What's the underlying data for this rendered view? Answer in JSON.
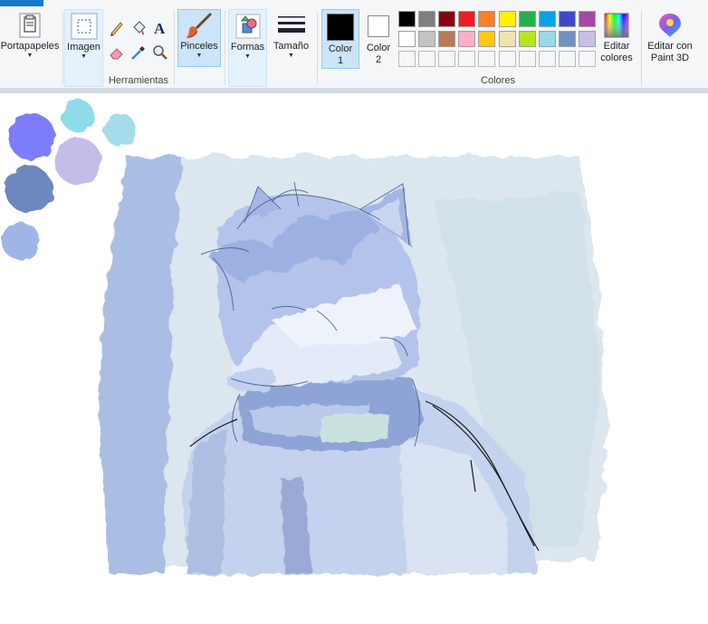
{
  "ribbon": {
    "clipboard": {
      "label": "Portapapeles",
      "icon": "clipboard-icon"
    },
    "image": {
      "label": "Imagen",
      "icon": "select-icon"
    },
    "tools": {
      "group_label": "Herramientas",
      "items": [
        "pencil-icon",
        "fill-icon",
        "text-icon",
        "eraser-icon",
        "color-picker-icon",
        "magnifier-icon"
      ]
    },
    "brushes": {
      "label": "Pinceles",
      "icon": "brush-icon",
      "selected": true
    },
    "shapes": {
      "label": "Formas",
      "icon": "shapes-icon"
    },
    "size": {
      "label": "Tamaño",
      "icon": "line-size-icon"
    },
    "color1": {
      "label": "Color",
      "label2": "1",
      "value": "#000000"
    },
    "color2": {
      "label": "Color",
      "label2": "2",
      "value": "#ffffff"
    },
    "colors_group_label": "Colores",
    "palette_row1": [
      "#000000",
      "#7f7f7f",
      "#880015",
      "#ed1c24",
      "#ff7f27",
      "#fff200",
      "#22b14c",
      "#00a2e8",
      "#3f48cc",
      "#a349a4"
    ],
    "palette_row2": [
      "#ffffff",
      "#c3c3c3",
      "#b97a57",
      "#ffaec9",
      "#ffc90e",
      "#efe4b0",
      "#b5e61d",
      "#99d9ea",
      "#7092be",
      "#c8bfe7"
    ],
    "palette_row3_count": 10,
    "edit_colors": {
      "label": "Editar",
      "label2": "colores"
    },
    "paint3d": {
      "label": "Editar con",
      "label2": "Paint 3D"
    }
  },
  "canvas": {
    "palette_blobs": [
      "#7b7dfb",
      "#8fdbe8",
      "#a5dcec",
      "#c4bdea",
      "#6d88bd",
      "#9fb5e8"
    ],
    "artwork": "painted sketch of an anthropomorphic wolf wearing a scarf"
  }
}
